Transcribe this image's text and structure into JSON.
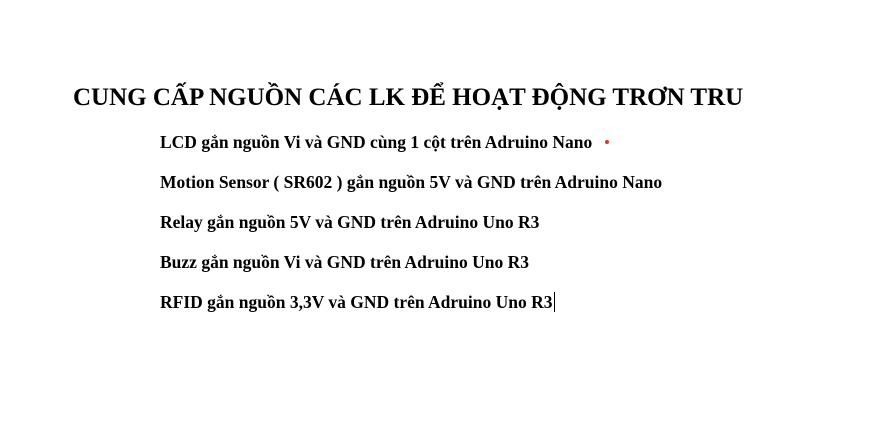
{
  "document": {
    "heading": "CUNG CẤP NGUỒN CÁC LK ĐỂ HOẠT ĐỘNG TRƠN TRU",
    "lines": [
      "LCD gắn nguồn Vi và GND cùng 1 cột trên Adruino Nano",
      "Motion Sensor ( SR602 ) gắn nguồn 5V và GND trên Adruino Nano",
      "Relay gắn nguồn 5V và GND trên Adruino Uno R3",
      "Buzz gắn nguồn Vi và GND trên Adruino Uno R3",
      "RFID gắn nguồn 3,3V và GND trên Adruino Uno R3"
    ]
  },
  "colors": {
    "text": "#000000",
    "background": "#ffffff",
    "marker_dot": "#e03030",
    "caret": "#000000"
  }
}
